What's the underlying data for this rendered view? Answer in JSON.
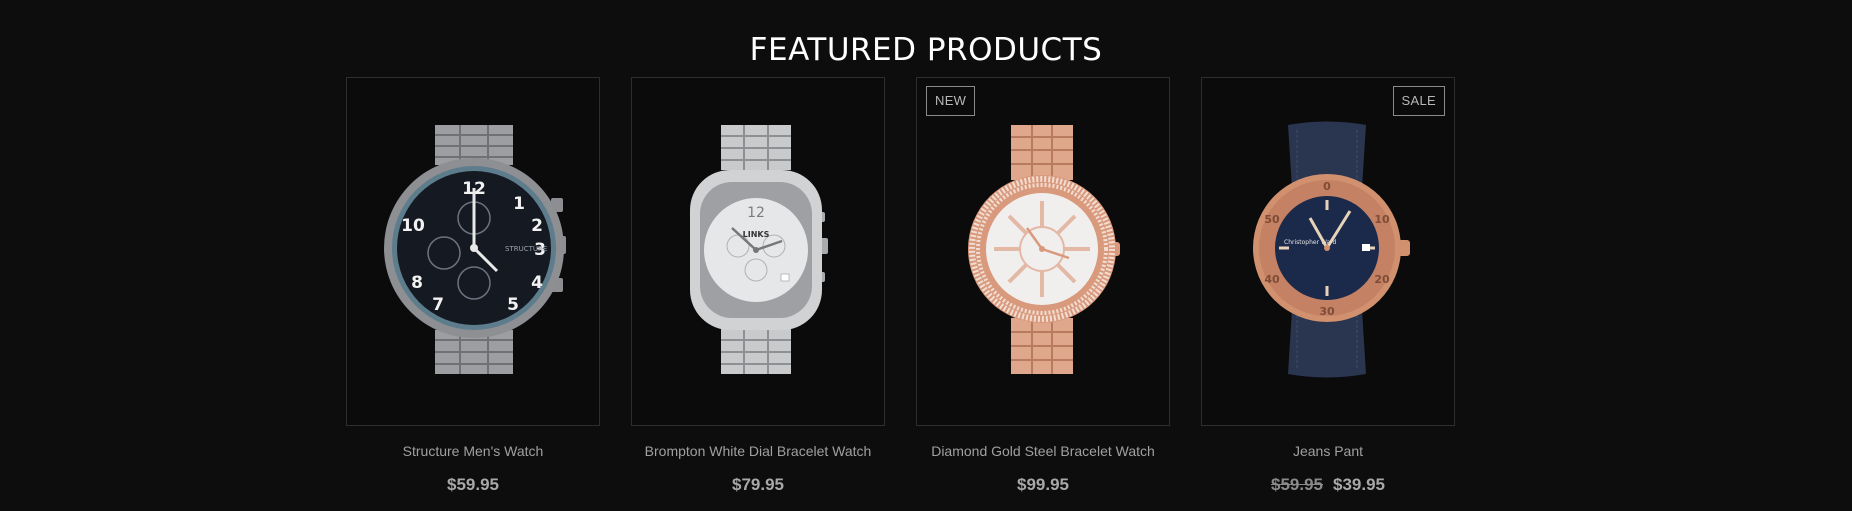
{
  "section": {
    "title": "FEATURED PRODUCTS"
  },
  "products": [
    {
      "name": "Structure Men's Watch",
      "price": "$59.95",
      "image_icon": "watch-black-dial-steel-icon",
      "dial_text": "STRUCTURE"
    },
    {
      "name": "Brompton White Dial Bracelet Watch",
      "price": "$79.95",
      "image_icon": "watch-white-dial-steel-icon",
      "dial_text": "LINKS"
    },
    {
      "name": "Diamond Gold Steel Bracelet Watch",
      "price": "$99.95",
      "badge": "NEW",
      "image_icon": "watch-rose-gold-diamond-icon"
    },
    {
      "name": "Jeans Pant",
      "old_price": "$59.95",
      "price": "$39.95",
      "badge": "SALE",
      "image_icon": "watch-blue-dial-denim-strap-icon",
      "dial_text": "Christopher Ward"
    }
  ],
  "colors": {
    "background": "#0d0d0d",
    "card_border": "#2e2e2e",
    "text_muted": "#a0a0a0",
    "steel": "#b9bbbd",
    "rose_gold": "#d9997c",
    "navy_dial": "#1b2a4a",
    "denim": "#2a3550"
  }
}
